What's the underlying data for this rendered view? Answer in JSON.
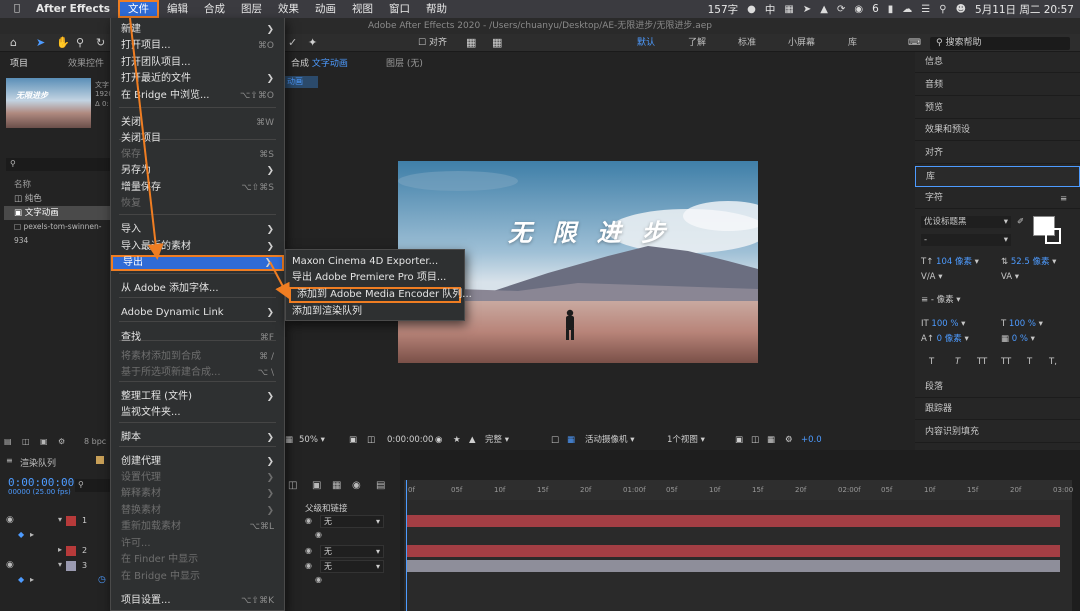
{
  "menubar": {
    "app_name": "After Effects",
    "items": [
      "文件",
      "编辑",
      "合成",
      "图层",
      "效果",
      "动画",
      "视图",
      "窗口",
      "帮助"
    ],
    "word_count": "157字",
    "ime": "中",
    "notif_count": "6",
    "datetime": "5月11日 周二  20:57"
  },
  "window_title": "Adobe After Effects 2020 - /Users/chuanyu/Desktop/AE-无限进步/无限进步.aep",
  "toolbar": {
    "snap_label": "对齐",
    "workspaces": [
      "默认",
      "了解",
      "标准",
      "小屏幕",
      "库"
    ],
    "search_placeholder": "搜索帮助"
  },
  "project_panel": {
    "tab_project": "项目",
    "tab_effects": "效果控件",
    "thumb_title": "无限进步",
    "thumb_meta": [
      "文字",
      "1920",
      "Δ 0:"
    ],
    "col_name": "名称",
    "items": [
      "纯色",
      "文字动画",
      "pexels-tom-swinnen-934"
    ],
    "bpc": "8 bpc"
  },
  "comp_viewer": {
    "tab_label": "合成",
    "tab_name": "文字动画",
    "layer_label": "图层 (无)",
    "crumb": "动画",
    "image_title": "无 限 进 步",
    "zoom": "50%",
    "timecode": "0:00:00:00",
    "quality": "完整",
    "camera": "活动摄像机",
    "views": "1个视图",
    "exposure": "+0.0"
  },
  "file_menu": {
    "items": [
      {
        "label": "新建",
        "arrow": true,
        "disabled": false
      },
      {
        "label": "打开项目...",
        "shortcut": "⌘O",
        "disabled": false
      },
      {
        "label": "打开团队项目...",
        "disabled": false
      },
      {
        "label": "打开最近的文件",
        "arrow": true,
        "disabled": false
      },
      {
        "label": "在 Bridge 中浏览...",
        "shortcut": "⌥⇧⌘O",
        "disabled": false
      },
      {
        "label": "关闭",
        "shortcut": "⌘W",
        "disabled": false
      },
      {
        "label": "关闭项目",
        "disabled": false
      },
      {
        "label": "保存",
        "shortcut": "⌘S",
        "disabled": true
      },
      {
        "label": "另存为",
        "arrow": true,
        "disabled": false
      },
      {
        "label": "增量保存",
        "shortcut": "⌥⇧⌘S",
        "disabled": false
      },
      {
        "label": "恢复",
        "disabled": true
      },
      {
        "label": "导入",
        "arrow": true,
        "disabled": false
      },
      {
        "label": "导入最近的素材",
        "arrow": true,
        "disabled": false
      },
      {
        "label": "导出",
        "arrow": true,
        "disabled": false,
        "active": true
      },
      {
        "label": "从 Adobe 添加字体...",
        "disabled": false
      },
      {
        "label": "Adobe Dynamic Link",
        "arrow": true,
        "disabled": false
      },
      {
        "label": "查找",
        "shortcut": "⌘F",
        "disabled": false
      },
      {
        "label": "将素材添加到合成",
        "shortcut": "⌘ /",
        "disabled": true
      },
      {
        "label": "基于所选项新建合成...",
        "shortcut": "⌥ \\",
        "disabled": true
      },
      {
        "label": "整理工程 (文件)",
        "arrow": true,
        "disabled": false
      },
      {
        "label": "监视文件夹...",
        "disabled": false
      },
      {
        "label": "脚本",
        "arrow": true,
        "disabled": false
      },
      {
        "label": "创建代理",
        "arrow": true,
        "disabled": false
      },
      {
        "label": "设置代理",
        "arrow": true,
        "disabled": true
      },
      {
        "label": "解释素材",
        "arrow": true,
        "disabled": true
      },
      {
        "label": "替换素材",
        "arrow": true,
        "disabled": true
      },
      {
        "label": "重新加载素材",
        "shortcut": "⌥⌘L",
        "disabled": true
      },
      {
        "label": "许可...",
        "disabled": true
      },
      {
        "label": "在 Finder 中显示",
        "disabled": true
      },
      {
        "label": "在 Bridge 中显示",
        "disabled": true
      },
      {
        "label": "项目设置...",
        "shortcut": "⌥⇧⌘K",
        "disabled": false
      }
    ]
  },
  "export_submenu": {
    "items": [
      "Maxon Cinema 4D Exporter...",
      "导出 Adobe Premiere Pro 项目...",
      "添加到 Adobe Media Encoder 队列...",
      "添加到渲染队列"
    ]
  },
  "right_panel": {
    "items": [
      "信息",
      "音频",
      "预览",
      "效果和预设",
      "对齐",
      "库",
      "字符"
    ],
    "font_name": "优设标题黑",
    "font_size": "104 像素",
    "leading": "52.5 像素",
    "tracking_unit": "- 像素",
    "vscale": "100 %",
    "hscale": "100 %",
    "baseline": "0 像素",
    "tsume": "0 %",
    "style_buttons": [
      "T",
      "T",
      "TT",
      "TT",
      "T",
      "T,"
    ],
    "lower_items": [
      "段落",
      "跟踪器",
      "内容识别填充"
    ]
  },
  "timeline": {
    "render_tab": "渲染队列",
    "timecode": "0:00:00:00",
    "fps": "00000 (25.00 fps)",
    "parent_header": "父级和链接",
    "layers": [
      {
        "num": "1",
        "color": "#b73a3a",
        "parent": "无"
      },
      {
        "num": "2",
        "color": "#b73a3a",
        "parent": "无"
      },
      {
        "num": "3",
        "color": "#9a9ab0",
        "parent": "无"
      }
    ],
    "ruler_ticks": [
      "0f",
      "05f",
      "10f",
      "15f",
      "20f",
      "01:00f",
      "05f",
      "10f",
      "15f",
      "20f",
      "02:00f",
      "05f",
      "10f",
      "15f",
      "20f",
      "03:00"
    ],
    "track_colors": [
      "#a33e44",
      "#a33e44",
      "#8e8e9a"
    ]
  }
}
